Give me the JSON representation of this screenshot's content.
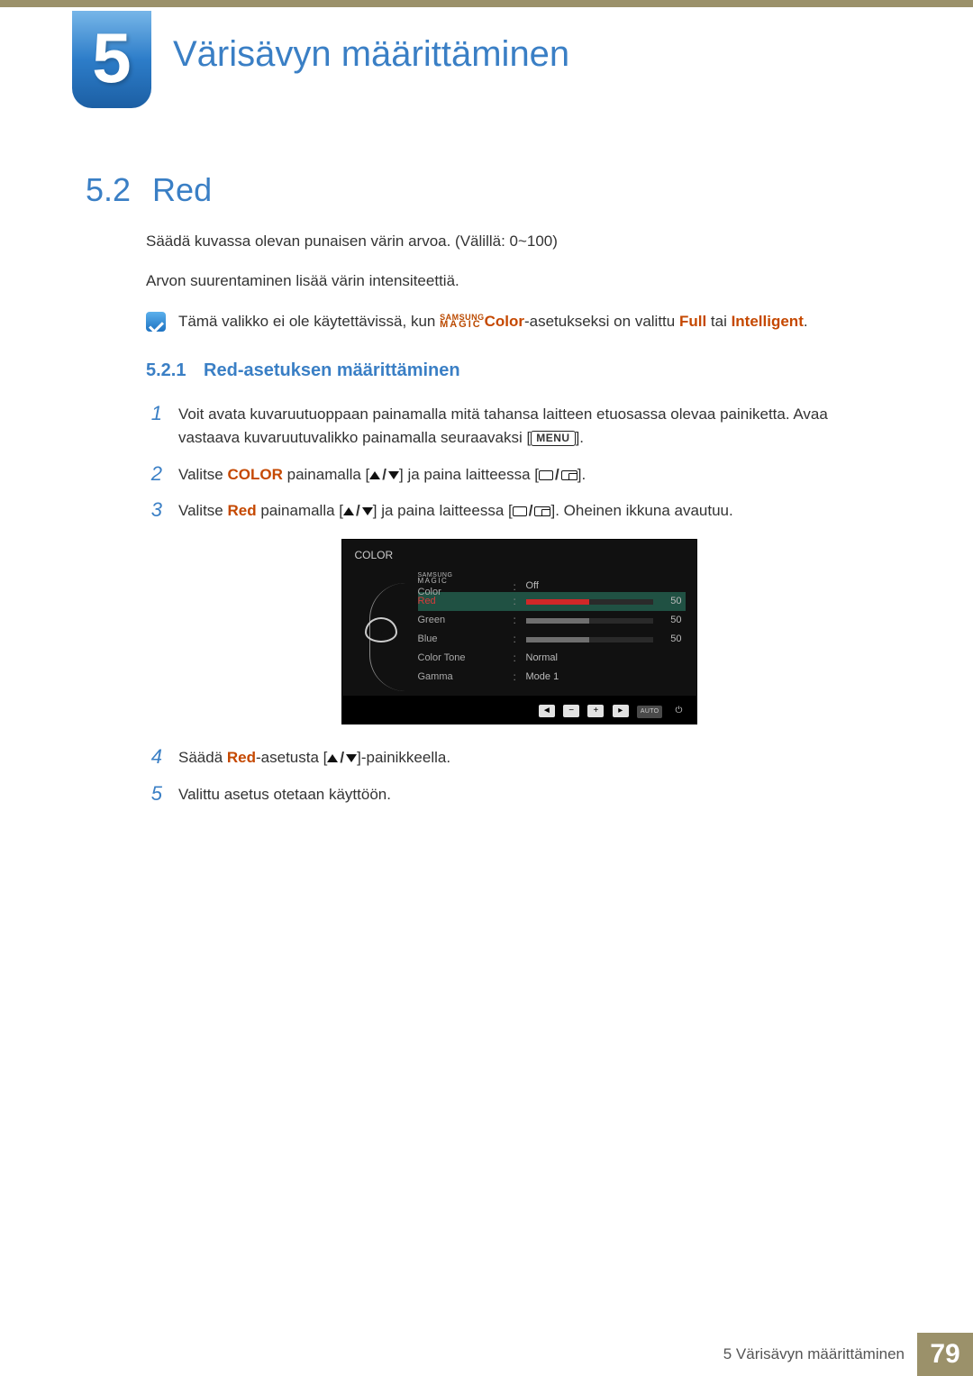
{
  "chapter": {
    "number": "5",
    "title": "Värisävyn määrittäminen"
  },
  "section": {
    "number": "5.2",
    "title": "Red"
  },
  "intro": {
    "p1": "Säädä kuvassa olevan punaisen värin arvoa. (Välillä: 0~100)",
    "p2": "Arvon suurentaminen lisää värin intensiteettiä."
  },
  "note": {
    "pre": "Tämä valikko ei ole käytettävissä, kun ",
    "logo_top": "SAMSUNG",
    "logo_bottom": "MAGIC",
    "mid1": "Color",
    "mid2": "-asetukseksi on valittu ",
    "opt1": "Full",
    "sep": " tai ",
    "opt2": "Intelligent",
    "end": "."
  },
  "subsection": {
    "number": "5.2.1",
    "title": "Red-asetuksen määrittäminen"
  },
  "steps": {
    "s1": {
      "a": "Voit avata kuvaruutuoppaan painamalla mitä tahansa laitteen etuosassa olevaa painiketta. Avaa vastaava kuvaruutuvalikko painamalla seuraavaksi [",
      "menu": "MENU",
      "b": "]."
    },
    "s2": {
      "a": "Valitse ",
      "color": "COLOR",
      "b": " painamalla [",
      "c": "] ja paina laitteessa [",
      "d": "]."
    },
    "s3": {
      "a": "Valitse ",
      "red": "Red",
      "b": " painamalla [",
      "c": "] ja paina laitteessa [",
      "d": "]. Oheinen ikkuna avautuu."
    },
    "s4": {
      "a": "Säädä ",
      "red": "Red",
      "b": "-asetusta [",
      "c": "]-painikkeella."
    },
    "s5": "Valittu asetus otetaan käyttöön."
  },
  "osd": {
    "title": "COLOR",
    "rows": [
      {
        "label_top": "SAMSUNG",
        "label_bottom": "MAGIC",
        "label_suffix": " Color",
        "value_text": "Off"
      },
      {
        "label": "Red",
        "value": 50,
        "fill_pct": 50,
        "color": "red",
        "highlight": true
      },
      {
        "label": "Green",
        "value": 50,
        "fill_pct": 50,
        "color": "grey"
      },
      {
        "label": "Blue",
        "value": 50,
        "fill_pct": 50,
        "color": "grey"
      },
      {
        "label": "Color Tone",
        "value_text": "Normal"
      },
      {
        "label": "Gamma",
        "value_text": "Mode 1"
      }
    ],
    "footer_auto": "AUTO"
  },
  "chart_data": {
    "type": "table",
    "title": "COLOR OSD menu",
    "rows": [
      {
        "setting": "SAMSUNG MAGIC Color",
        "value": "Off"
      },
      {
        "setting": "Red",
        "value": 50,
        "range": [
          0,
          100
        ],
        "selected": true
      },
      {
        "setting": "Green",
        "value": 50,
        "range": [
          0,
          100
        ]
      },
      {
        "setting": "Blue",
        "value": 50,
        "range": [
          0,
          100
        ]
      },
      {
        "setting": "Color Tone",
        "value": "Normal"
      },
      {
        "setting": "Gamma",
        "value": "Mode 1"
      }
    ]
  },
  "footer": {
    "text": "5 Värisävyn määrittäminen",
    "page": "79"
  }
}
